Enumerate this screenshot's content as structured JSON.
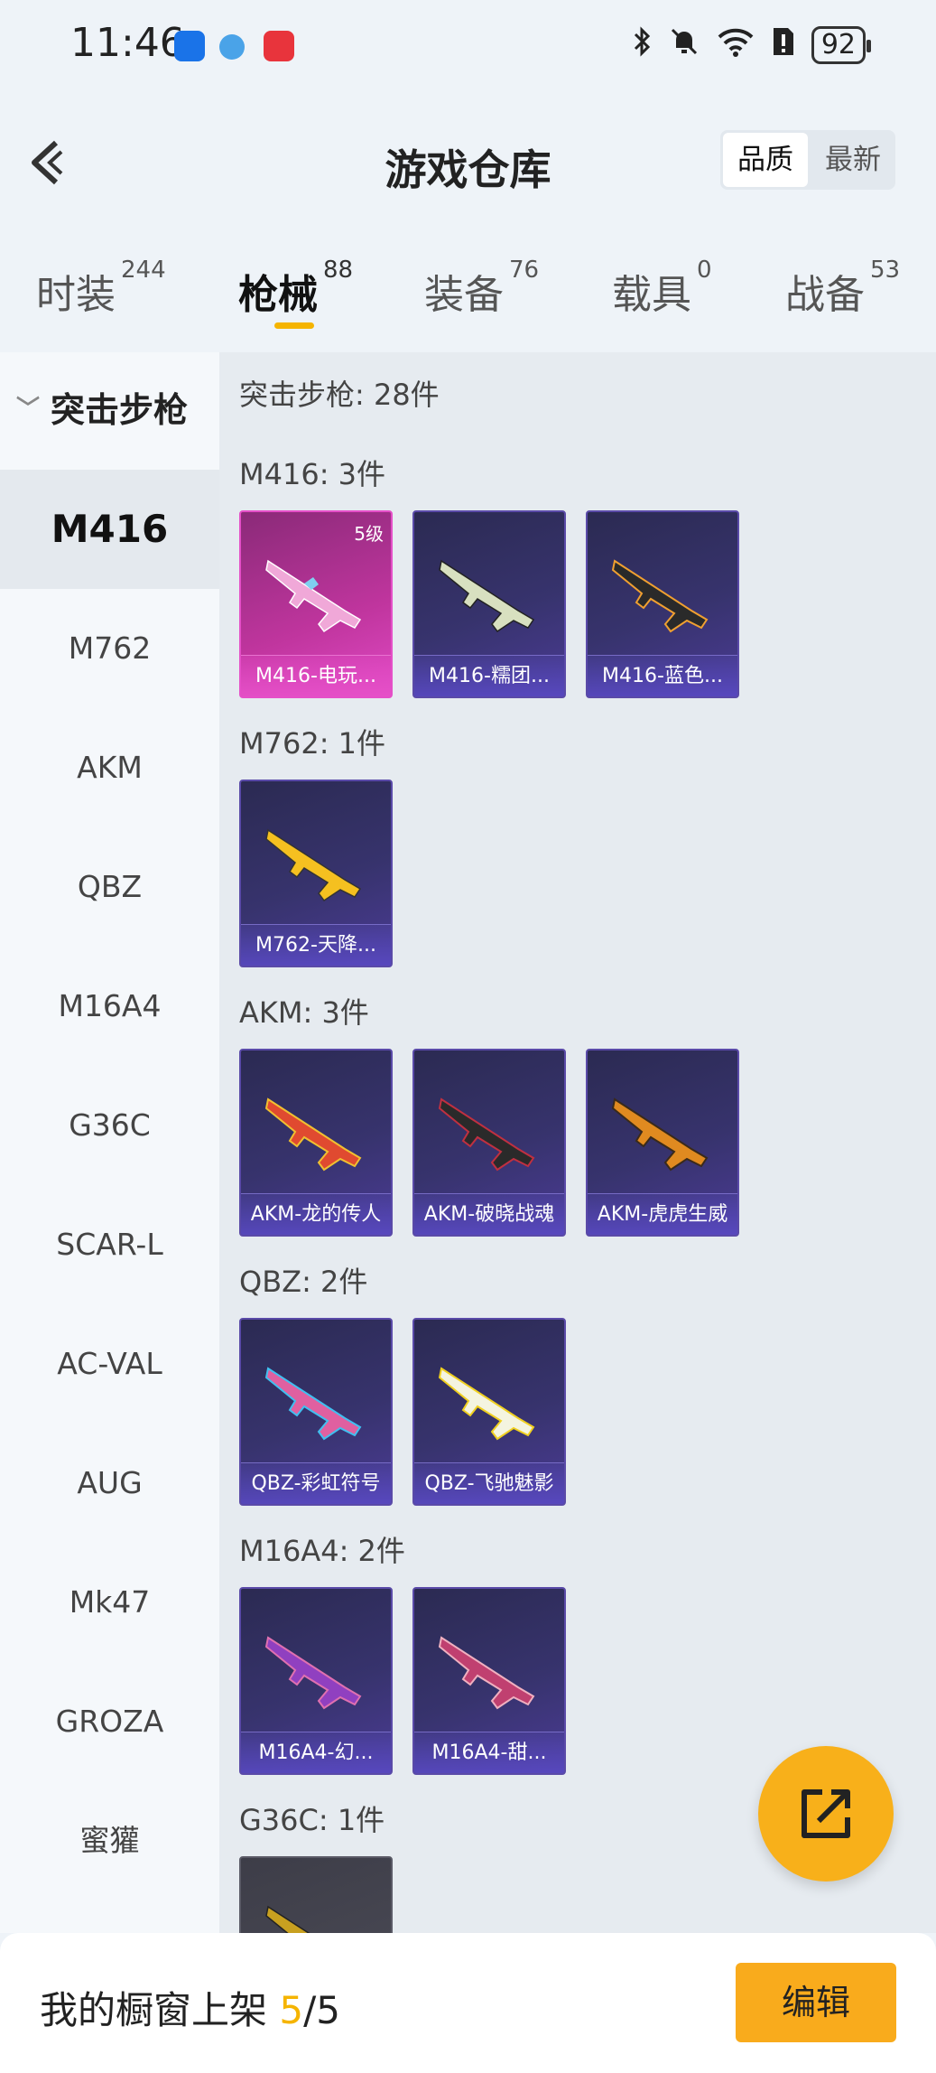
{
  "status": {
    "time": "11:46",
    "battery": "92"
  },
  "header": {
    "title": "游戏仓库",
    "sort_quality": "品质",
    "sort_latest": "最新"
  },
  "tabs": [
    {
      "label": "时装",
      "count": "244"
    },
    {
      "label": "枪械",
      "count": "88"
    },
    {
      "label": "装备",
      "count": "76"
    },
    {
      "label": "载具",
      "count": "0"
    },
    {
      "label": "战备",
      "count": "53"
    }
  ],
  "sidebar": {
    "category": "突击步枪",
    "items": [
      "M416",
      "M762",
      "AKM",
      "QBZ",
      "M16A4",
      "G36C",
      "SCAR-L",
      "AC-VAL",
      "AUG",
      "Mk47",
      "GROZA",
      "蜜獾"
    ]
  },
  "content": {
    "total": "突击步枪: 28件",
    "sections": [
      {
        "title": "M416: 3件",
        "cards": [
          {
            "name": "M416-电玩...",
            "level": "5级"
          },
          {
            "name": "M416-糯团..."
          },
          {
            "name": "M416-蓝色..."
          }
        ]
      },
      {
        "title": "M762: 1件",
        "cards": [
          {
            "name": "M762-天降..."
          }
        ]
      },
      {
        "title": "AKM: 3件",
        "cards": [
          {
            "name": "AKM-龙的传人"
          },
          {
            "name": "AKM-破晓战魂"
          },
          {
            "name": "AKM-虎虎生威"
          }
        ]
      },
      {
        "title": "QBZ: 2件",
        "cards": [
          {
            "name": "QBZ-彩虹符号"
          },
          {
            "name": "QBZ-飞驰魅影"
          }
        ]
      },
      {
        "title": "M16A4: 2件",
        "cards": [
          {
            "name": "M16A4-幻..."
          },
          {
            "name": "M16A4-甜..."
          }
        ]
      },
      {
        "title": "G36C: 1件"
      }
    ]
  },
  "bottom": {
    "shelf_label": "我的橱窗上架",
    "shelf_count": "5",
    "shelf_total": "/5",
    "edit_label": "编辑"
  },
  "colors": {
    "accent": "#f5b400",
    "button": "#f9ab1c",
    "card_purple": "#37336d",
    "card_pink": "#c0359e"
  }
}
